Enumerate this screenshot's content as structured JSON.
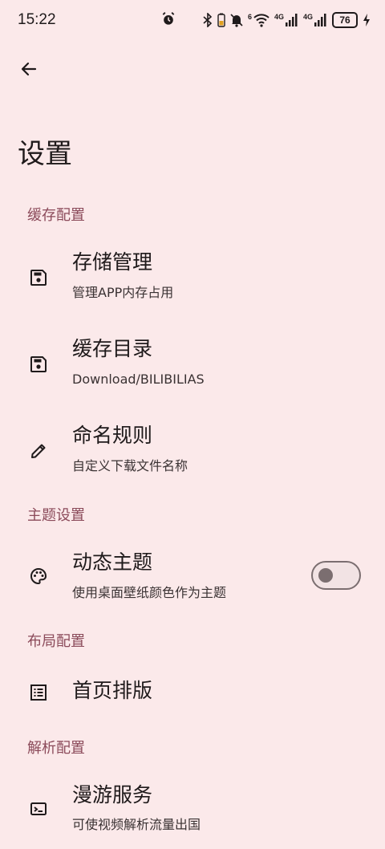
{
  "status_bar": {
    "time": "15:22",
    "battery": "76",
    "network_1": "4G",
    "network_2": "4G",
    "wifi_label": "6"
  },
  "header": {
    "title": "设置"
  },
  "sections": {
    "cache": {
      "header": "缓存配置",
      "storage": {
        "title": "存储管理",
        "summary": "管理APP内存占用",
        "icon": "save-icon"
      },
      "directory": {
        "title": "缓存目录",
        "summary": "Download/BILIBILIAS",
        "icon": "save-icon"
      },
      "naming": {
        "title": "命名规则",
        "summary": "自定义下载文件名称",
        "icon": "pencil-icon"
      }
    },
    "theme": {
      "header": "主题设置",
      "dynamic": {
        "title": "动态主题",
        "summary": "使用桌面壁纸颜色作为主题",
        "icon": "palette-icon",
        "enabled": false
      }
    },
    "layout": {
      "header": "布局配置",
      "home": {
        "title": "首页排版",
        "icon": "list-icon"
      }
    },
    "parse": {
      "header": "解析配置",
      "roaming": {
        "title": "漫游服务",
        "summary": "可使视频解析流量出国",
        "icon": "ticket-icon"
      }
    }
  },
  "colors": {
    "background": "#FBE9EA",
    "section_header": "#8B4A5A",
    "switch_outline": "#7B6E70"
  }
}
